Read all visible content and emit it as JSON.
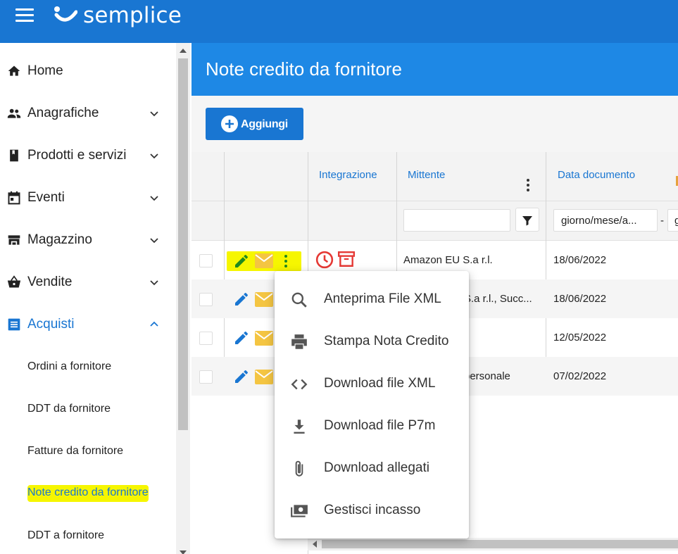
{
  "app": {
    "brand": "semplice"
  },
  "sidebar": {
    "items": [
      {
        "label": "Home",
        "icon": "home-icon"
      },
      {
        "label": "Anagrafiche",
        "icon": "people-icon"
      },
      {
        "label": "Prodotti e servizi",
        "icon": "book-icon"
      },
      {
        "label": "Eventi",
        "icon": "calendar-icon"
      },
      {
        "label": "Magazzino",
        "icon": "warehouse-icon"
      },
      {
        "label": "Vendite",
        "icon": "basket-icon"
      },
      {
        "label": "Acquisti",
        "icon": "list-icon",
        "expanded": true
      }
    ],
    "subitems": [
      {
        "label": "Ordini a fornitore"
      },
      {
        "label": "DDT da fornitore"
      },
      {
        "label": "Fatture da fornitore"
      },
      {
        "label": "Note credito da fornitore",
        "active": true
      },
      {
        "label": "DDT a fornitore"
      }
    ]
  },
  "page": {
    "title": "Note credito da fornitore"
  },
  "toolbar": {
    "add_label": "Aggiungi"
  },
  "table": {
    "columns": [
      "Integrazione",
      "Mittente",
      "Data documento"
    ],
    "filters": {
      "date_placeholder": "giorno/mese/a...",
      "date_to_partial": "g",
      "sender_value": ""
    },
    "rows": [
      {
        "sender": "Amazon EU S.a r.l.",
        "date": "18/06/2022"
      },
      {
        "sender": "S.a r.l., Succ...",
        "date": "18/06/2022"
      },
      {
        "sender": "",
        "date": "12/05/2022"
      },
      {
        "sender": "personale",
        "date": "07/02/2022"
      }
    ]
  },
  "context_menu": {
    "items": [
      {
        "label": "Anteprima File XML",
        "icon": "search-icon"
      },
      {
        "label": "Stampa Nota Credito",
        "icon": "printer-icon"
      },
      {
        "label": "Download file XML",
        "icon": "code-icon"
      },
      {
        "label": "Download file P7m",
        "icon": "download-icon"
      },
      {
        "label": "Download allegati",
        "icon": "paperclip-icon"
      },
      {
        "label": "Gestisci incasso",
        "icon": "cash-icon"
      }
    ]
  },
  "colors": {
    "primary": "#1976d2",
    "header": "#1e88e5",
    "highlight": "#f6f600",
    "status_red": "#e53935",
    "mail_yellow": "#f4c542"
  }
}
